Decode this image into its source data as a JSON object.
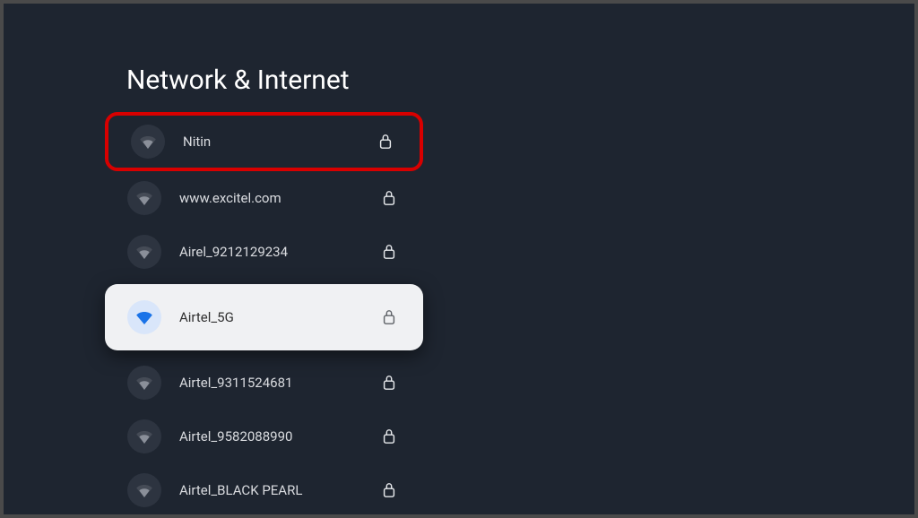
{
  "title": "Network & Internet",
  "networks": [
    {
      "name": "Nitin",
      "secured": true,
      "signal": "medium",
      "state": "marked"
    },
    {
      "name": "www.excitel.com",
      "secured": true,
      "signal": "medium",
      "state": "normal"
    },
    {
      "name": "Airel_9212129234",
      "secured": true,
      "signal": "medium",
      "state": "normal"
    },
    {
      "name": "Airtel_5G",
      "secured": true,
      "signal": "strong",
      "state": "focused"
    },
    {
      "name": "Airtel_9311524681",
      "secured": true,
      "signal": "medium",
      "state": "normal"
    },
    {
      "name": "Airtel_9582088990",
      "secured": true,
      "signal": "medium",
      "state": "normal"
    },
    {
      "name": "Airtel_BLACK PEARL",
      "secured": true,
      "signal": "medium",
      "state": "normal"
    }
  ],
  "colors": {
    "bg": "#1e2530",
    "focusBg": "#f0f1f3",
    "marked": "#d80000",
    "wifiFocused": "#1a73e8"
  }
}
